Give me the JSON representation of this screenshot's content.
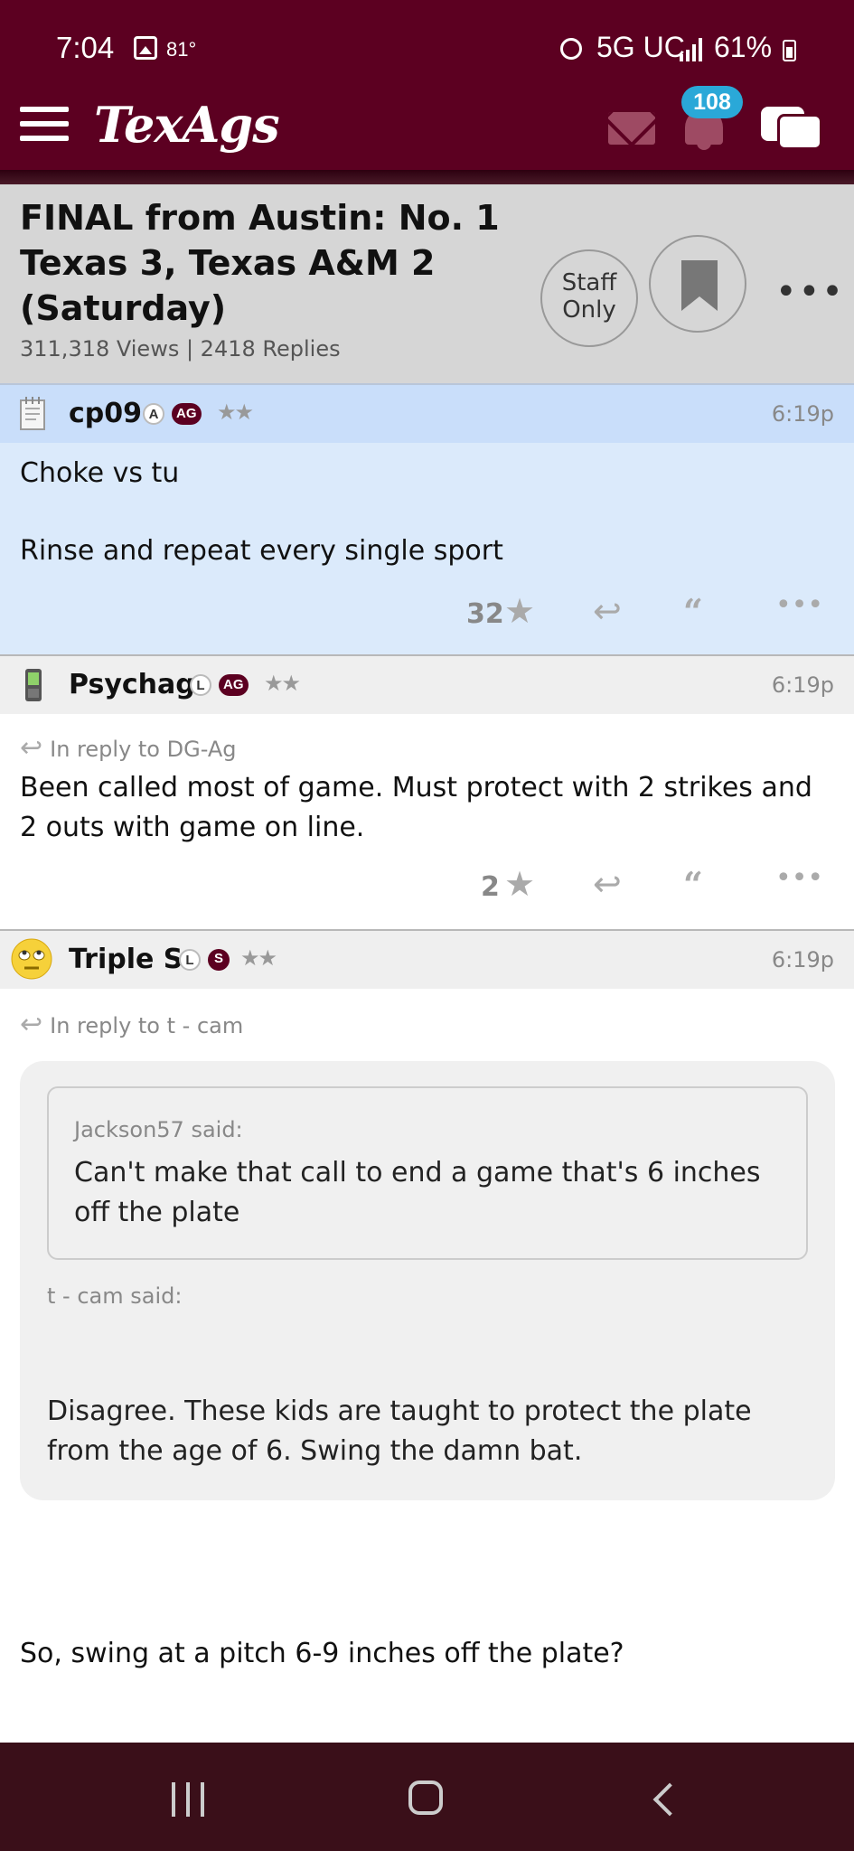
{
  "status_bar": {
    "time": "7:04",
    "temperature": "81°",
    "network": "5G UC",
    "battery": "61%"
  },
  "header": {
    "logo": "TexAgs",
    "notification_count": "108"
  },
  "thread": {
    "title": "FINAL from Austin: No. 1 Texas 3, Texas A&M 2 (Saturday)",
    "meta": "311,318 Views | 2418 Replies",
    "staff_only_label": "Staff Only"
  },
  "posts": [
    {
      "username": "cp09",
      "badge1": "A",
      "badge2": "AG",
      "stars": "★★",
      "time": "6:19p",
      "body_line1": "Choke vs tu",
      "body_line2": "Rinse and repeat every single sport",
      "likes": "32"
    },
    {
      "username": "Psychag",
      "badge1": "L",
      "badge2": "AG",
      "stars": "★★",
      "time": "6:19p",
      "reply_to": "In reply to DG-Ag",
      "body": "Been called most of game. Must protect with 2 strikes and 2 outs with game on line.",
      "likes": "2"
    },
    {
      "username": "Triple S",
      "badge1": "L",
      "badge2": "S",
      "stars": "★★",
      "time": "6:19p",
      "reply_to": "In reply to t - cam",
      "inner_quote_author": "Jackson57 said:",
      "inner_quote_text": "Can't make that call to end a game that's 6 inches off the plate",
      "outer_quote_author": "t - cam said:",
      "outer_quote_text": "Disagree. These kids are taught to protect the plate from the age of 6. Swing the damn bat.",
      "body": "So, swing at a pitch 6-9 inches off the plate?"
    }
  ],
  "colors": {
    "brand_maroon": "#5c0021",
    "highlight_blue": "#dbeafb",
    "badge_blue": "#2aa8d8"
  }
}
